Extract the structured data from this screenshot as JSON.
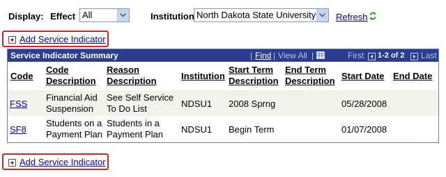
{
  "filters": {
    "display_label": "Display:",
    "effect_label": "Effect",
    "effect_value": "All",
    "institution_label": "Institution",
    "institution_value": "North Dakota State University",
    "refresh_label": "Refresh"
  },
  "add_link": {
    "label": "Add Service Indicator"
  },
  "grid": {
    "title": "Service Indicator Summary",
    "find": "Find",
    "view_all": "View All",
    "first": "First",
    "range": "1-2 of 2",
    "last": "Last",
    "columns": {
      "code": "Code",
      "code_desc_1": "Code",
      "code_desc_2": "Description",
      "reason_1": "Reason",
      "reason_2": "Description",
      "institution": "Institution",
      "start_term_1": "Start Term",
      "start_term_2": "Description",
      "end_term_1": "End Term",
      "end_term_2": "Description",
      "start_date": "Start Date",
      "end_date": "End Date"
    },
    "rows": [
      {
        "code": "FSS",
        "code_desc_1": "Financial Aid",
        "code_desc_2": "Suspension",
        "reason_1": "See Self Service",
        "reason_2": "To Do List",
        "institution": "NDSU1",
        "start_term": "2008 Sprng",
        "end_term": "",
        "start_date": "05/28/2008",
        "end_date": ""
      },
      {
        "code": "SF8",
        "code_desc_1": "Students on a",
        "code_desc_2": "Payment Plan",
        "reason_1": "Students in a",
        "reason_2": "Payment Plan",
        "institution": "NDSU1",
        "start_term": "Begin Term",
        "end_term": "",
        "start_date": "01/07/2008",
        "end_date": ""
      }
    ]
  },
  "icons": {
    "refresh": "refresh-icon",
    "dropdown": "chevron-down-icon",
    "add": "plus-box-icon",
    "download": "spreadsheet-icon",
    "prev": "arrow-left-icon",
    "next": "arrow-right-icon"
  },
  "colors": {
    "header_bg": "#2a3d8f",
    "link": "#0000cc",
    "highlight_box": "#dd2222",
    "row_alt": "#f3f3ec"
  }
}
